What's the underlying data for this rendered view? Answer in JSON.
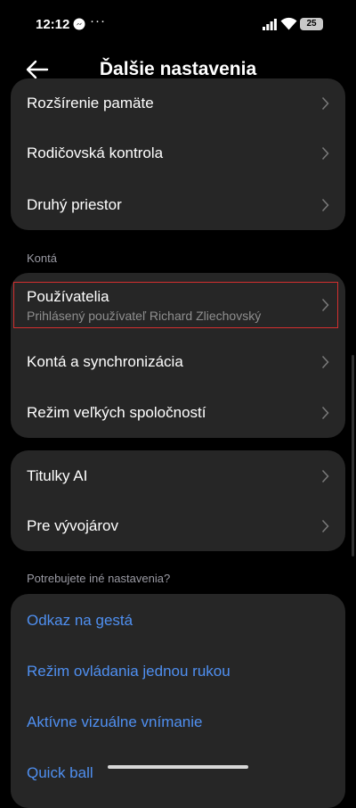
{
  "status_bar": {
    "time": "12:12",
    "notification_icon": "messenger-icon",
    "more_notifications": "···",
    "battery_level": "25"
  },
  "header": {
    "back_icon": "arrow-left-icon",
    "title": "Ďalšie nastavenia"
  },
  "groups": [
    {
      "items": [
        {
          "label": "Rozšírenie pamäte"
        },
        {
          "label": "Rodičovská kontrola"
        },
        {
          "label": "Druhý priestor"
        }
      ]
    },
    {
      "section_label": "Kontá",
      "items": [
        {
          "label": "Používatelia",
          "subtitle": "Prihlásený používateľ Richard Zliechovský"
        },
        {
          "label": "Kontá a synchronizácia"
        },
        {
          "label": "Režim veľkých spoločností"
        }
      ]
    },
    {
      "items": [
        {
          "label": "Titulky AI"
        },
        {
          "label": "Pre vývojárov"
        }
      ]
    },
    {
      "section_label": "Potrebujete iné nastavenia?",
      "items": [
        {
          "label": "Odkaz na gestá"
        },
        {
          "label": "Režim ovládania jednou rukou"
        },
        {
          "label": "Aktívne vizuálne vnímanie"
        },
        {
          "label": "Quick ball"
        }
      ]
    }
  ],
  "colors": {
    "background": "#000000",
    "card": "#262626",
    "link_blue": "#4f8ff0",
    "highlight_border": "#d32f2f"
  }
}
